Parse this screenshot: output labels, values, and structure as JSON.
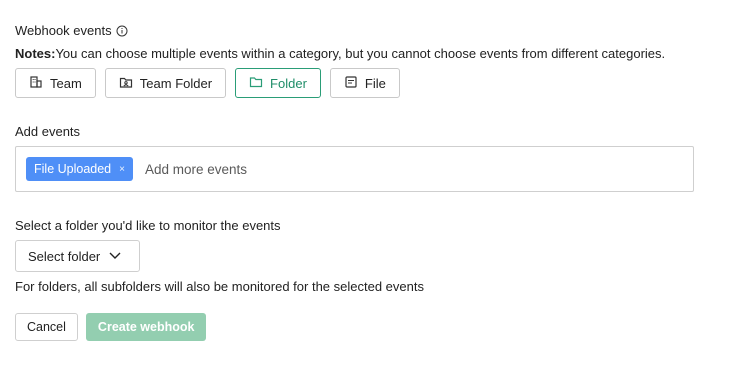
{
  "header": {
    "title": "Webhook events",
    "notes_label": "Notes:",
    "notes_text": "You can choose multiple events within a category, but you cannot choose events from different categories."
  },
  "categories": [
    {
      "label": "Team",
      "icon": "building-icon",
      "active": false
    },
    {
      "label": "Team Folder",
      "icon": "team-folder-icon",
      "active": false
    },
    {
      "label": "Folder",
      "icon": "folder-icon",
      "active": true
    },
    {
      "label": "File",
      "icon": "file-icon",
      "active": false
    }
  ],
  "events": {
    "label": "Add events",
    "chips": [
      {
        "label": "File Uploaded",
        "remove": "×"
      }
    ],
    "placeholder": "Add more events"
  },
  "folder": {
    "label": "Select a folder you'd like to monitor the events",
    "select_label": "Select folder",
    "help": "For folders, all subfolders will also be monitored for the selected events"
  },
  "actions": {
    "cancel": "Cancel",
    "create": "Create webhook"
  },
  "colors": {
    "accent": "#2a9d77",
    "chip": "#4f8ff7",
    "create_disabled": "#93ceb0"
  }
}
